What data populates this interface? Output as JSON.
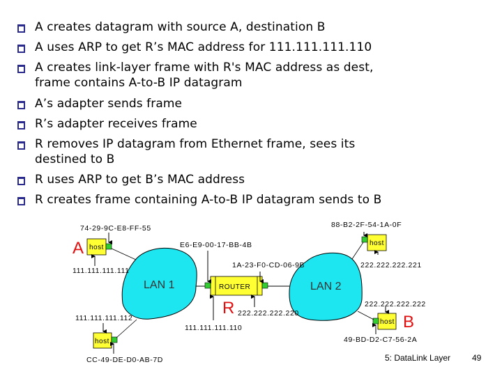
{
  "bullets": [
    {
      "lines": [
        "A creates datagram with source A, destination B"
      ]
    },
    {
      "lines": [
        "A uses ARP to get R’s MAC address for 111.111.111.110"
      ]
    },
    {
      "lines": [
        "A creates link-layer frame with R's MAC address as dest,",
        "frame contains A-to-B IP datagram"
      ]
    },
    {
      "lines": [
        "A’s adapter sends frame"
      ]
    },
    {
      "lines": [
        "R’s adapter receives frame"
      ]
    },
    {
      "lines": [
        "R removes IP datagram from Ethernet frame, sees its",
        "destined to B"
      ]
    },
    {
      "lines": [
        "R uses ARP to get B’s MAC address"
      ]
    },
    {
      "lines": [
        "R creates frame containing A-to-B IP datagram sends to B"
      ]
    }
  ],
  "diagram": {
    "host_label": "host",
    "router_label": "ROUTER",
    "lan1_label": "LAN 1",
    "lan2_label": "LAN 2",
    "node_a": {
      "name": "A",
      "mac": "74-29-9C-E8-FF-55",
      "ip": "111.111.111.111"
    },
    "node_a2": {
      "mac": "CC-49-DE-D0-AB-7D",
      "ip": "111.111.111.112"
    },
    "router": {
      "name": "R",
      "mac_lan1": "E6-E9-00-17-BB-4B",
      "ip_lan1": "111.111.111.110",
      "mac_lan2": "1A-23-F0-CD-06-9B",
      "ip_lan2": "222.222.222.220"
    },
    "node_b": {
      "name": "B",
      "mac": "49-BD-D2-C7-56-2A",
      "ip": "222.222.222.222"
    },
    "node_b2": {
      "mac": "88-B2-2F-54-1A-0F",
      "ip": "222.222.222.221"
    },
    "colors": {
      "lan_fill": "#1ee6f0",
      "host_fill": "#ffff33",
      "adapter_fill": "#33cc33",
      "node_letter": "#e01010",
      "bullet_box": "#2a2a8c"
    }
  },
  "footer": {
    "chapter": "5: DataLink Layer",
    "page": "49"
  }
}
